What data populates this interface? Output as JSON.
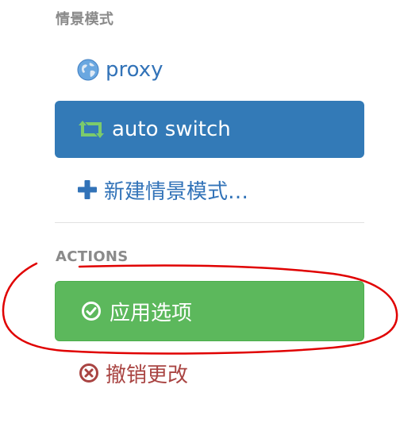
{
  "profiles": {
    "header": "情景模式",
    "items": [
      {
        "label": "proxy",
        "icon": "globe-icon",
        "icon_color": "#4a90d9"
      },
      {
        "label": "auto switch",
        "icon": "retweet-icon",
        "icon_color": "#7ccb6b",
        "active": true,
        "active_bg": "#337ab7"
      },
      {
        "label": "新建情景模式…",
        "icon": "plus-icon",
        "icon_color": "#3273b8"
      }
    ]
  },
  "actions": {
    "header": "ACTIONS",
    "apply_label": "应用选项",
    "apply_icon": "check-circle-icon",
    "apply_bg": "#5cb85c",
    "revert_label": "撤销更改",
    "revert_icon": "times-circle-icon",
    "revert_color": "#a94442"
  },
  "annotation": {
    "shape": "hand-drawn-ellipse",
    "color": "#e00000"
  }
}
